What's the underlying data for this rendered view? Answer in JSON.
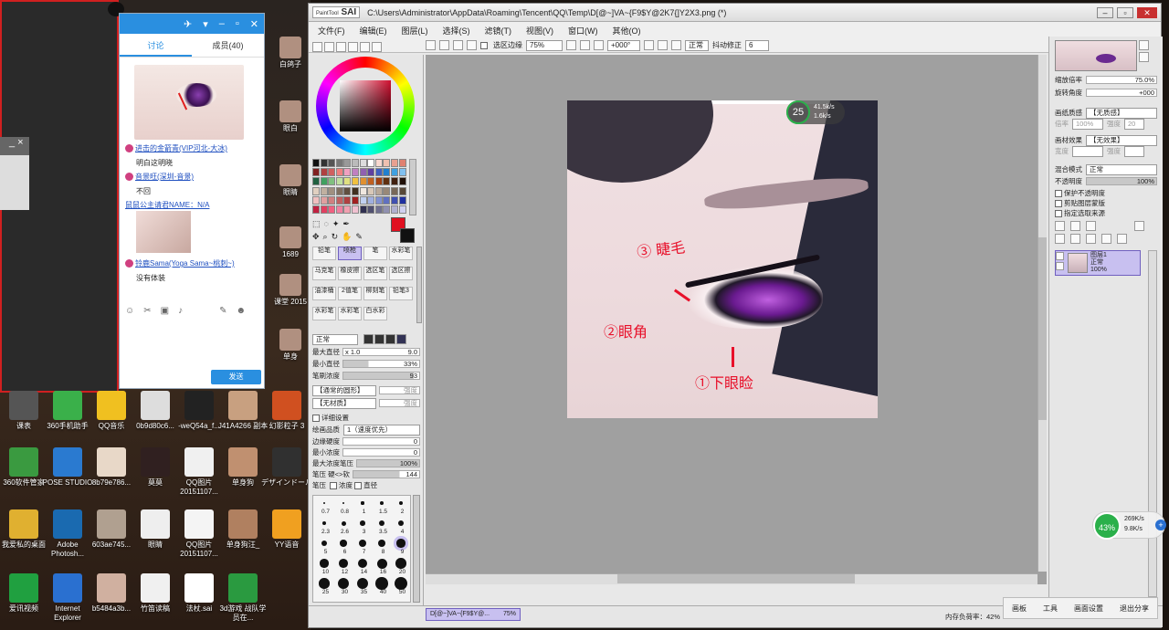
{
  "desktop": {
    "icons": [
      {
        "label": "课表",
        "color": "#555"
      },
      {
        "label": "360手机助手",
        "color": "#3ab04a"
      },
      {
        "label": "QQ音乐",
        "color": "#f0c020"
      },
      {
        "label": "0b9d80c6...",
        "color": "#ddd"
      },
      {
        "label": "-weQ54a_f...",
        "color": "#222"
      },
      {
        "label": "J41A4266 副本",
        "color": "#c8a080"
      },
      {
        "label": "幻影粒子 3",
        "color": "#d05020"
      },
      {
        "label": "360软件管家",
        "color": "#3a9a40",
        "badge": "12"
      },
      {
        "label": "POSE STUDIO",
        "color": "#2a7ad0"
      },
      {
        "label": "8b79e786...",
        "color": "#e8d8c8"
      },
      {
        "label": "莫莫",
        "color": "#302020"
      },
      {
        "label": "QQ图片 20151107...",
        "color": "#f0f0f0"
      },
      {
        "label": "单身狗",
        "color": "#c09070"
      },
      {
        "label": "デザインドール",
        "color": "#303030"
      },
      {
        "label": "我爱私的桌面",
        "color": "#e0b030"
      },
      {
        "label": "Adobe Photosh...",
        "color": "#1a6ab0"
      },
      {
        "label": "603ae745...",
        "color": "#b0a090"
      },
      {
        "label": "眼睛",
        "color": "#eee"
      },
      {
        "label": "QQ图片 20151107...",
        "color": "#f4f4f4"
      },
      {
        "label": "单身狗汪_",
        "color": "#b08060"
      },
      {
        "label": "YY语音",
        "color": "#f0a020"
      },
      {
        "label": "爱讯视频",
        "color": "#20a040"
      },
      {
        "label": "Internet Explorer",
        "color": "#2a70d0"
      },
      {
        "label": "b5484a3b...",
        "color": "#d0b0a0"
      },
      {
        "label": "竹笛读稿",
        "color": "#f0f0f0"
      },
      {
        "label": "法杖.sai",
        "color": "#fff"
      },
      {
        "label": "3d游戏 战队学员在...",
        "color": "#2a9a40"
      }
    ],
    "side_labels": [
      {
        "label": "白鸽子"
      },
      {
        "label": "眼白"
      },
      {
        "label": "眼睛"
      },
      {
        "label": "1689"
      },
      {
        "label": "课堂 2015"
      },
      {
        "label": "单身"
      }
    ]
  },
  "qq": {
    "tabs": [
      "讨论",
      "成员(40)"
    ],
    "messages": [
      {
        "name": "进击的金箭青(VIP河北-大冰)",
        "text": "明白这明晓"
      },
      {
        "name": "音景旺(深圳-音景)",
        "text": "不回"
      },
      {
        "name": "鼠鼠公主请君NAME：N/A",
        "text": ""
      },
      {
        "name": "铃鹿Sama(Yoga Sama~桃刺~)",
        "text": "没有体装"
      }
    ],
    "send_label": "发送"
  },
  "sai": {
    "app_name": "SAI",
    "logo": "PaintTool",
    "path": "C:\\Users\\Administrator\\AppData\\Roaming\\Tencent\\QQ\\Temp\\D[@~]VA~{F9$Y@2K7{]Y2X3.png (*)",
    "menus": [
      "文件(F)",
      "编辑(E)",
      "图层(L)",
      "选择(S)",
      "滤镜(T)",
      "视图(V)",
      "窗口(W)",
      "其他(O)"
    ],
    "toolbar": {
      "anti_alias": "选区边缘",
      "zoom": "75%",
      "rotation": "+000°",
      "mode": "正常",
      "stabilizer_label": "抖动修正",
      "stabilizer": "6"
    },
    "brushes": [
      "铅笔",
      "喷枪",
      "笔",
      "水彩笔",
      "马克笔",
      "橡皮擦",
      "选区笔",
      "选区擦",
      "油漆桶",
      "2值笔",
      "柳刻笔",
      "铅笔3",
      "水彩笔",
      "水彩笔",
      "白水彩"
    ],
    "brush_settings": {
      "blend": "正常",
      "max_size_label": "最大直径",
      "max_size": "x 1.0",
      "max_size_val": "9.0",
      "min_size_label": "最小直径",
      "min_size": "33%",
      "density_label": "笔刷浓度",
      "density": "93",
      "shape": "【通常的圆形】",
      "shape_val": "强度",
      "texture": "【无材质】",
      "texture_val": "强度",
      "detail_label": "详细设置",
      "quality_label": "绘画品质",
      "quality": "1（速度优先）",
      "edge_label": "边缘硬度",
      "edge": "0",
      "min_density_label": "最小浓度",
      "min_density": "0",
      "max_pressure_label": "最大浓度笔压",
      "max_pressure": "100%",
      "pressure_label": "笔压 硬<>软",
      "pressure": "144",
      "pressure2": "笔压",
      "pressure_density": "浓度",
      "pressure_size": "直径"
    },
    "brush_sizes": [
      "0.7",
      "0.8",
      "1",
      "1.5",
      "2",
      "2.3",
      "2.6",
      "3",
      "3.5",
      "4",
      "5",
      "6",
      "7",
      "8",
      "9",
      "10",
      "12",
      "14",
      "16",
      "20",
      "25",
      "30",
      "35",
      "40",
      "50"
    ],
    "canvas": {
      "annotations": [
        "③ 睫毛",
        "②眼角",
        "①下眼睑"
      ],
      "badge": "25",
      "speed_up": "41.5k/s",
      "speed_down": "1.6k/s"
    },
    "right": {
      "zoom_label": "缩放倍率",
      "zoom": "75.0%",
      "angle_label": "旋转角度",
      "angle": "+000",
      "paper_texture_label": "画纸质感",
      "paper_texture": "【无质感】",
      "paper_texture_sub1": "倍率",
      "paper_texture_v1": "100%",
      "paper_texture_sub2": "强度",
      "paper_texture_v2": "20",
      "paper_effect_label": "画材效果",
      "paper_effect": "【无效果】",
      "paper_effect_sub1": "宽度",
      "paper_effect_sub2": "强度",
      "blend_label": "混合模式",
      "blend": "正常",
      "opacity_label": "不透明度",
      "opacity": "100%",
      "opt1": "保护不透明度",
      "opt2": "剪贴图层蒙版",
      "opt3": "指定选取来源",
      "layer_name": "图层1",
      "layer_mode": "正常",
      "layer_opacity": "100%"
    },
    "status": {
      "tab": "D[@~]VA~{F9$Y@...",
      "tab_zoom": "75%",
      "memory": "内存负荷率：42%"
    }
  },
  "taskbar": {
    "items": [
      "画板",
      "工具",
      "画面设置",
      "退出分享"
    ]
  },
  "net_widget": {
    "percent": "43%",
    "up": "269K/s",
    "down": "9.8K/s"
  },
  "colors": {
    "accent": "#2a8fe0",
    "red_annotation": "#e8102a",
    "layer_selected": "#c8c0f0"
  }
}
